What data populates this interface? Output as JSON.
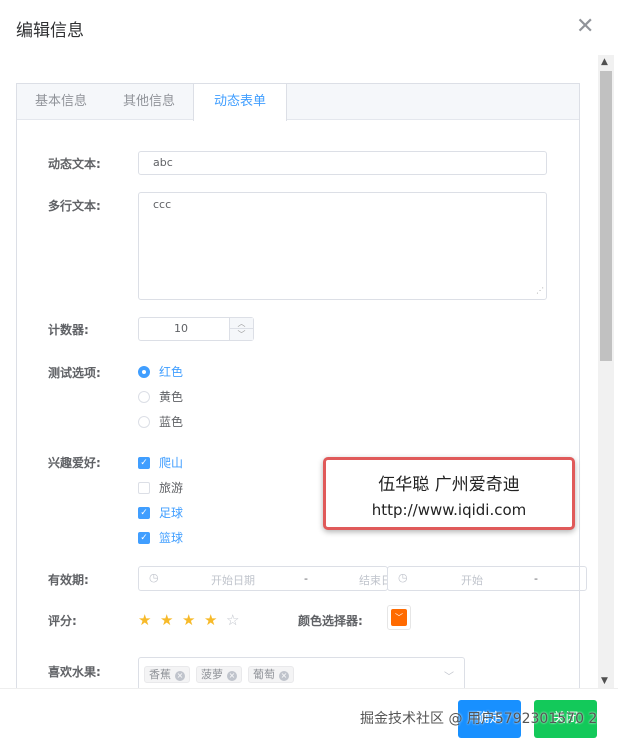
{
  "dialog": {
    "title": "编辑信息"
  },
  "tabs": [
    {
      "label": "基本信息"
    },
    {
      "label": "其他信息"
    },
    {
      "label": "动态表单"
    }
  ],
  "form": {
    "text_label": "动态文本:",
    "text_value": "abc",
    "textarea_label": "多行文本:",
    "textarea_value": "ccc",
    "counter_label": "计数器:",
    "counter_value": "10",
    "radio_label": "测试选项:",
    "radio_options": [
      "红色",
      "黄色",
      "蓝色"
    ],
    "checkbox_label": "兴趣爱好:",
    "checkbox_options": [
      "爬山",
      "旅游",
      "足球",
      "篮球"
    ],
    "date_label": "有效期:",
    "date_start_placeholder": "开始日期",
    "date_sep": "-",
    "date_end_placeholder": "结束日",
    "date2_start_placeholder": "开始",
    "date2_sep": "-",
    "rate_label": "评分:",
    "rate_value": 4,
    "rate_max": 5,
    "color_label": "颜色选择器:",
    "color_value": "#ff6a00",
    "fruit_label": "喜欢水果:",
    "fruit_tags": [
      "香蕉",
      "菠萝",
      "葡萄"
    ]
  },
  "overlay": {
    "line1": "伍华聪 广州爱奇迪",
    "line2": "http://www.iqidi.com"
  },
  "footer": {
    "confirm": "确定",
    "close": "关闭",
    "watermark": "掘金技术社区 @ 用户5792301570 2"
  }
}
